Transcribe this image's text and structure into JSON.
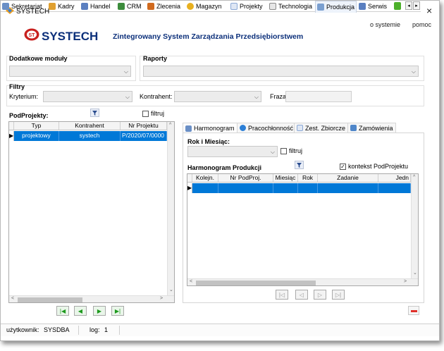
{
  "window": {
    "title": "SYSTECH",
    "menu": [
      "o systemie",
      "pomoc"
    ],
    "close_glyph": "×"
  },
  "banner": {
    "logo_text": "SYSTECH",
    "subtitle": "Zintegrowany System Zarządzania Przedsiębiorstwem"
  },
  "modules": [
    {
      "label": "Sekretariat",
      "icon": "folder-icon",
      "color": "#6a8fc6"
    },
    {
      "label": "Kadry",
      "icon": "people-icon",
      "color": "#e0a030"
    },
    {
      "label": "Handel",
      "icon": "handshake-icon",
      "color": "#5a7fc0"
    },
    {
      "label": "CRM",
      "icon": "chart-icon",
      "color": "#3c8c3c"
    },
    {
      "label": "Zlecenia",
      "icon": "bar-chart-icon",
      "color": "#d06a1e"
    },
    {
      "label": "Magazyn",
      "icon": "warehouse-icon",
      "color": "#e8b020"
    },
    {
      "label": "Projekty",
      "icon": "document-icon",
      "color": "#8aa8d6"
    },
    {
      "label": "Technologia",
      "icon": "gear-document-icon",
      "color": "#8a8a8a"
    },
    {
      "label": "Produkcja",
      "icon": "factory-icon",
      "color": "#7a9fd0"
    },
    {
      "label": "Serwis",
      "icon": "tools-icon",
      "color": "#5a7fc0"
    }
  ],
  "active_module": "Produkcja",
  "overflow_icon": "puzzle-icon",
  "sections": {
    "additional_modules": "Dodatkowe moduły",
    "reports": "Raporty",
    "filters": "Filtry",
    "criterion_label": "Kryterium:",
    "contractor_label": "Kontrahent:",
    "phrase_label": "Fraza:"
  },
  "left": {
    "title": "PodProjekty:",
    "filter_label": "filtruj",
    "columns": [
      "Typ",
      "Kontrahent",
      "Nr Projektu"
    ],
    "rows": [
      {
        "typ": "projektowy",
        "kontrahent": "systech",
        "nr": "P/2020/07/0000"
      }
    ]
  },
  "tabs": [
    {
      "label": "Harmonogram",
      "icon": "link-icon",
      "color": "#6a8fc6"
    },
    {
      "label": "Pracochłonność",
      "icon": "refresh-icon",
      "color": "#2c7fd6"
    },
    {
      "label": "Zest. Zbiorcze",
      "icon": "list-icon",
      "color": "#8aa8d6"
    },
    {
      "label": "Zamówienia",
      "icon": "order-icon",
      "color": "#4f86c9"
    }
  ],
  "active_tab": "Harmonogram",
  "right": {
    "year_month_label": "Rok i Miesiąc:",
    "filter_label": "filtruj",
    "schedule_title": "Harmonogram Produkcji",
    "context_label": "kontekst PodProjektu",
    "context_checked": true,
    "columns": [
      "Kolejn.",
      "Nr PodProj.",
      "Miesiąc",
      "Rok",
      "Zadanie",
      "Jedn"
    ]
  },
  "status": {
    "user_label": "użytkownik:",
    "user": "SYSDBA",
    "log_label": "log:",
    "log": "1"
  },
  "colors": {
    "accent": "#0078d7",
    "banner": "#0b2f7a",
    "nav_green": "#1e9a1e",
    "delete_red": "#e0302a"
  }
}
